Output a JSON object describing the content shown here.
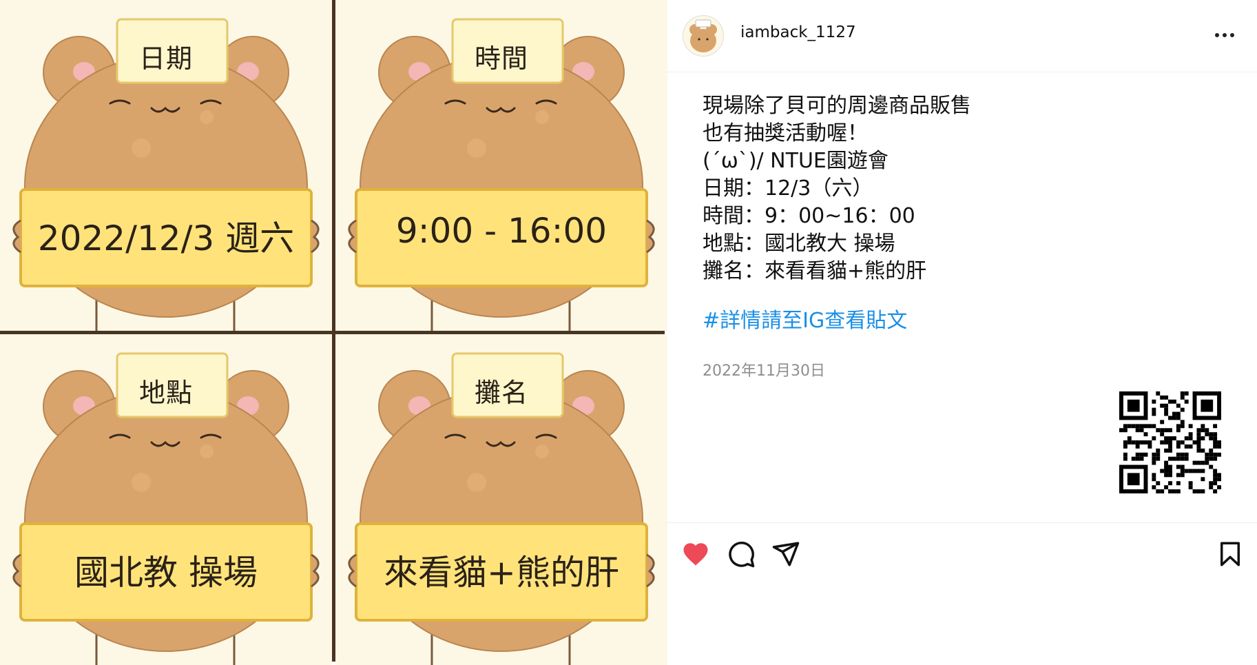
{
  "image": {
    "panels": [
      {
        "tag": "日期",
        "sign": "2022/12/3 週六"
      },
      {
        "tag": "時間",
        "sign": "9:00 - 16:00"
      },
      {
        "tag": "地點",
        "sign": "國北教 操場"
      },
      {
        "tag": "攤名",
        "sign": "來看貓+熊的肝"
      }
    ],
    "colors": {
      "background": "#fdf8e6",
      "bear": "#d9a46c",
      "sign": "#ffe37a",
      "grid": "#4a3422"
    }
  },
  "post": {
    "username": "iamback_1127",
    "avatar_icon": "bear-avatar-icon",
    "more_icon": "ellipsis-icon",
    "caption": [
      "現場除了貝可的周邊商品販售",
      "也有抽獎活動喔！",
      "(´ω`)/ NTUE園遊會",
      "日期：12/3（六）",
      "時間：9：00~16：00",
      "地點：國北教大 操場",
      "攤名：來看看貓+熊的肝"
    ],
    "hashtag": "#詳情請至IG查看貼文",
    "date": "2022年11月30日",
    "hashtag_color": "#1a8fe6",
    "actions": {
      "like_icon": "heart-icon",
      "like_color": "#ed4956",
      "comment_icon": "comment-icon",
      "share_icon": "send-icon",
      "save_icon": "bookmark-icon"
    }
  }
}
